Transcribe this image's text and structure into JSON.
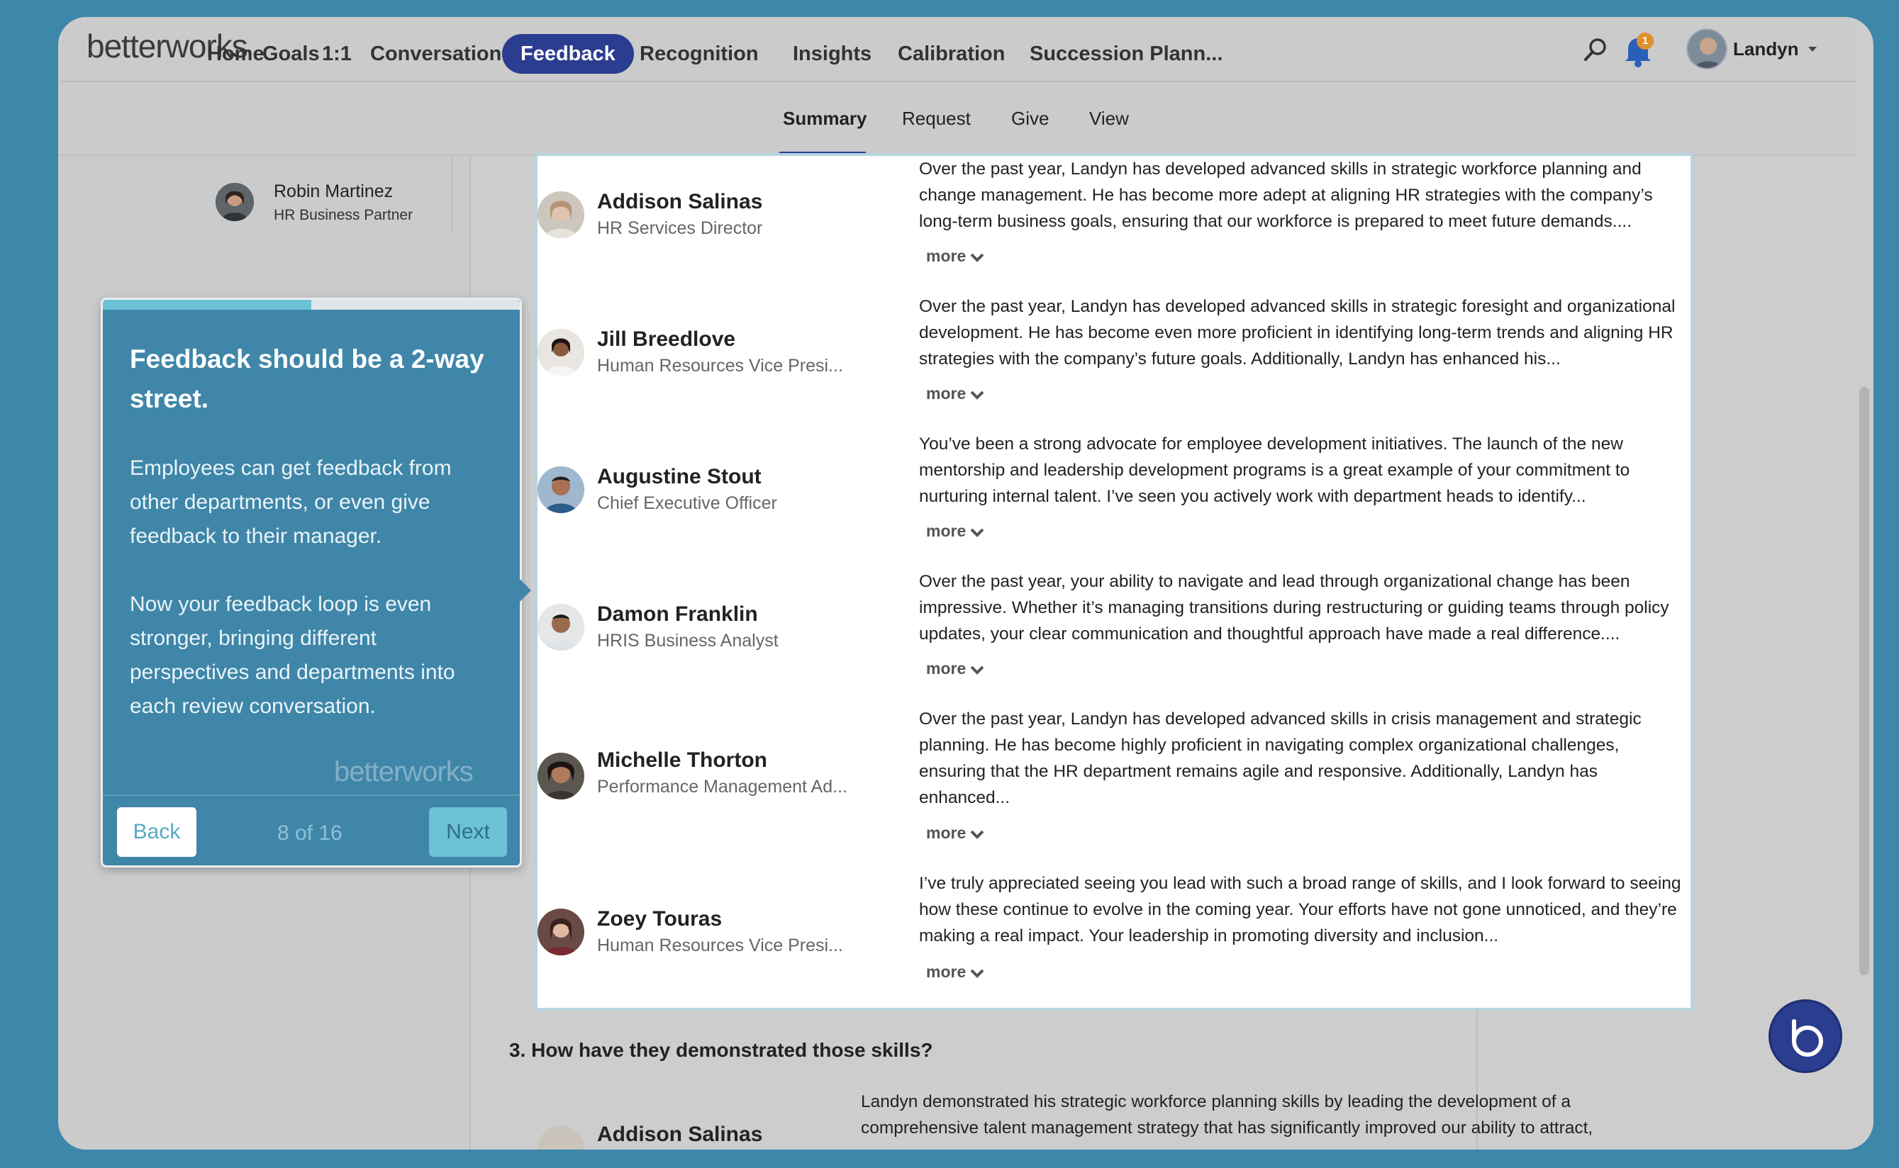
{
  "brand": {
    "logo": "betterworks"
  },
  "nav": {
    "items": [
      {
        "label": "Home"
      },
      {
        "label": "Goals"
      },
      {
        "label": "1:1"
      },
      {
        "label": "Conversations"
      },
      {
        "label": "Feedback"
      },
      {
        "label": "Recognition"
      },
      {
        "label": "Insights"
      },
      {
        "label": "Calibration"
      },
      {
        "label": "Succession Plann..."
      }
    ],
    "active": "Feedback",
    "notification_count": "1",
    "user": "Landyn"
  },
  "subnav": {
    "items": [
      {
        "label": "Summary"
      },
      {
        "label": "Request"
      },
      {
        "label": "Give"
      },
      {
        "label": "View"
      }
    ],
    "active": "Summary"
  },
  "left": {
    "person": {
      "name": "Robin Martinez",
      "title": "HR Business Partner"
    }
  },
  "tour": {
    "title": "Feedback should be a 2-way street.",
    "paragraphs": [
      "Employees can get feedback from other departments, or even give feedback to their manager.",
      "Now your feedback loop is even stronger, bringing different perspectives and departments into each review conversation."
    ],
    "watermark": "betterworks",
    "back_label": "Back",
    "next_label": "Next",
    "counter": "8 of 16",
    "progress": 0.5
  },
  "feedback": {
    "more_label": "more",
    "rows": [
      {
        "name": "Addison Salinas",
        "role": "HR Services Director",
        "text": "Over the past year, Landyn has developed advanced skills in strategic workforce planning and change management. He has become more adept at aligning HR strategies with the company’s long-term business goals, ensuring that our workforce is prepared to meet future demands...."
      },
      {
        "name": "Jill Breedlove",
        "role": "Human Resources Vice Presi...",
        "text": "Over the past year, Landyn has developed advanced skills in strategic foresight and organizational development. He has become even more proficient in identifying long-term trends and aligning HR strategies with the company’s future goals. Additionally, Landyn has enhanced his..."
      },
      {
        "name": "Augustine Stout",
        "role": "Chief Executive Officer",
        "text": "You’ve been a strong advocate for employee development initiatives. The launch of the new mentorship and leadership development programs is a great example of your commitment to nurturing internal talent. I’ve seen you actively work with department heads to identify..."
      },
      {
        "name": "Damon Franklin",
        "role": "HRIS Business Analyst",
        "text": "Over the past year, your ability to navigate and lead through organizational change has been impressive. Whether it’s managing transitions during restructuring or guiding teams through policy updates, your clear communication and thoughtful approach have made a real difference...."
      },
      {
        "name": "Michelle Thorton",
        "role": "Performance Management Ad...",
        "text": "Over the past year, Landyn has developed advanced skills in crisis management and strategic planning. He has become highly proficient in navigating complex organizational challenges, ensuring that the HR department remains agile and responsive. Additionally, Landyn has enhanced..."
      },
      {
        "name": "Zoey Touras",
        "role": "Human Resources Vice Presi...",
        "text": "I’ve truly appreciated seeing you lead with such a broad range of skills, and I look forward to seeing how these continue to evolve in the coming year. Your efforts have not gone unnoticed, and they’re making a real impact. Your leadership in promoting diversity and inclusion..."
      }
    ]
  },
  "question3": {
    "label": "3.  How have they demonstrated those skills?",
    "first_name": "Addison Salinas",
    "first_text": "Landyn demonstrated his strategic workforce planning skills by leading the development of a comprehensive talent management strategy that has significantly improved our ability to attract,"
  },
  "colors": {
    "accent": "#2a3d8f",
    "tour_bg": "#3f86a9",
    "page_bg": "#3d87ab"
  },
  "icons": [
    "search-icon",
    "bell-icon",
    "chevron-down-icon",
    "help-icon"
  ]
}
